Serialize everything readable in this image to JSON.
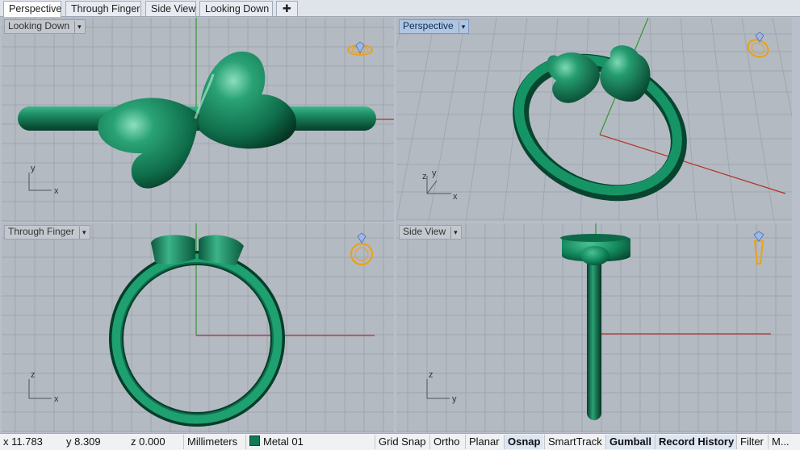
{
  "tabs": [
    {
      "label": "Perspective",
      "active": true
    },
    {
      "label": "Through Finger",
      "active": false
    },
    {
      "label": "Side View",
      "active": false
    },
    {
      "label": "Looking Down",
      "active": false
    }
  ],
  "tab_add_label": "✚",
  "viewports": {
    "top_left": {
      "label": "Looking Down",
      "axis_u": "x",
      "axis_v": "y",
      "icon": "ring-top-icon"
    },
    "top_right": {
      "label": "Perspective",
      "axis_u": "x",
      "axis_v": "y",
      "axis_w": "z",
      "icon": "ring-perspective-icon",
      "active": true
    },
    "bottom_left": {
      "label": "Through Finger",
      "axis_u": "x",
      "axis_v": "z",
      "icon": "ring-front-icon"
    },
    "bottom_right": {
      "label": "Side View",
      "axis_u": "y",
      "axis_v": "z",
      "icon": "ring-side-icon"
    }
  },
  "dropdown_glyph": "▾",
  "status": {
    "x": "x 11.783",
    "y": "y 8.309",
    "z": "z 0.000",
    "units": "Millimeters",
    "layer": "Metal 01",
    "layer_color": "#107a55",
    "toggles": [
      {
        "label": "Grid Snap",
        "on": false
      },
      {
        "label": "Ortho",
        "on": false
      },
      {
        "label": "Planar",
        "on": false
      },
      {
        "label": "Osnap",
        "on": true
      },
      {
        "label": "SmartTrack",
        "on": false
      },
      {
        "label": "Gumball",
        "on": true
      },
      {
        "label": "Record History",
        "on": true
      },
      {
        "label": "Filter",
        "on": false
      },
      {
        "label": "M...",
        "on": false
      }
    ]
  },
  "colors": {
    "metal": "#0f7a55",
    "grid_line": "#9aa1aa",
    "x_axis": "#b5302a",
    "y_axis": "#2f9a2f",
    "icon_gold": "#e8a21c"
  }
}
